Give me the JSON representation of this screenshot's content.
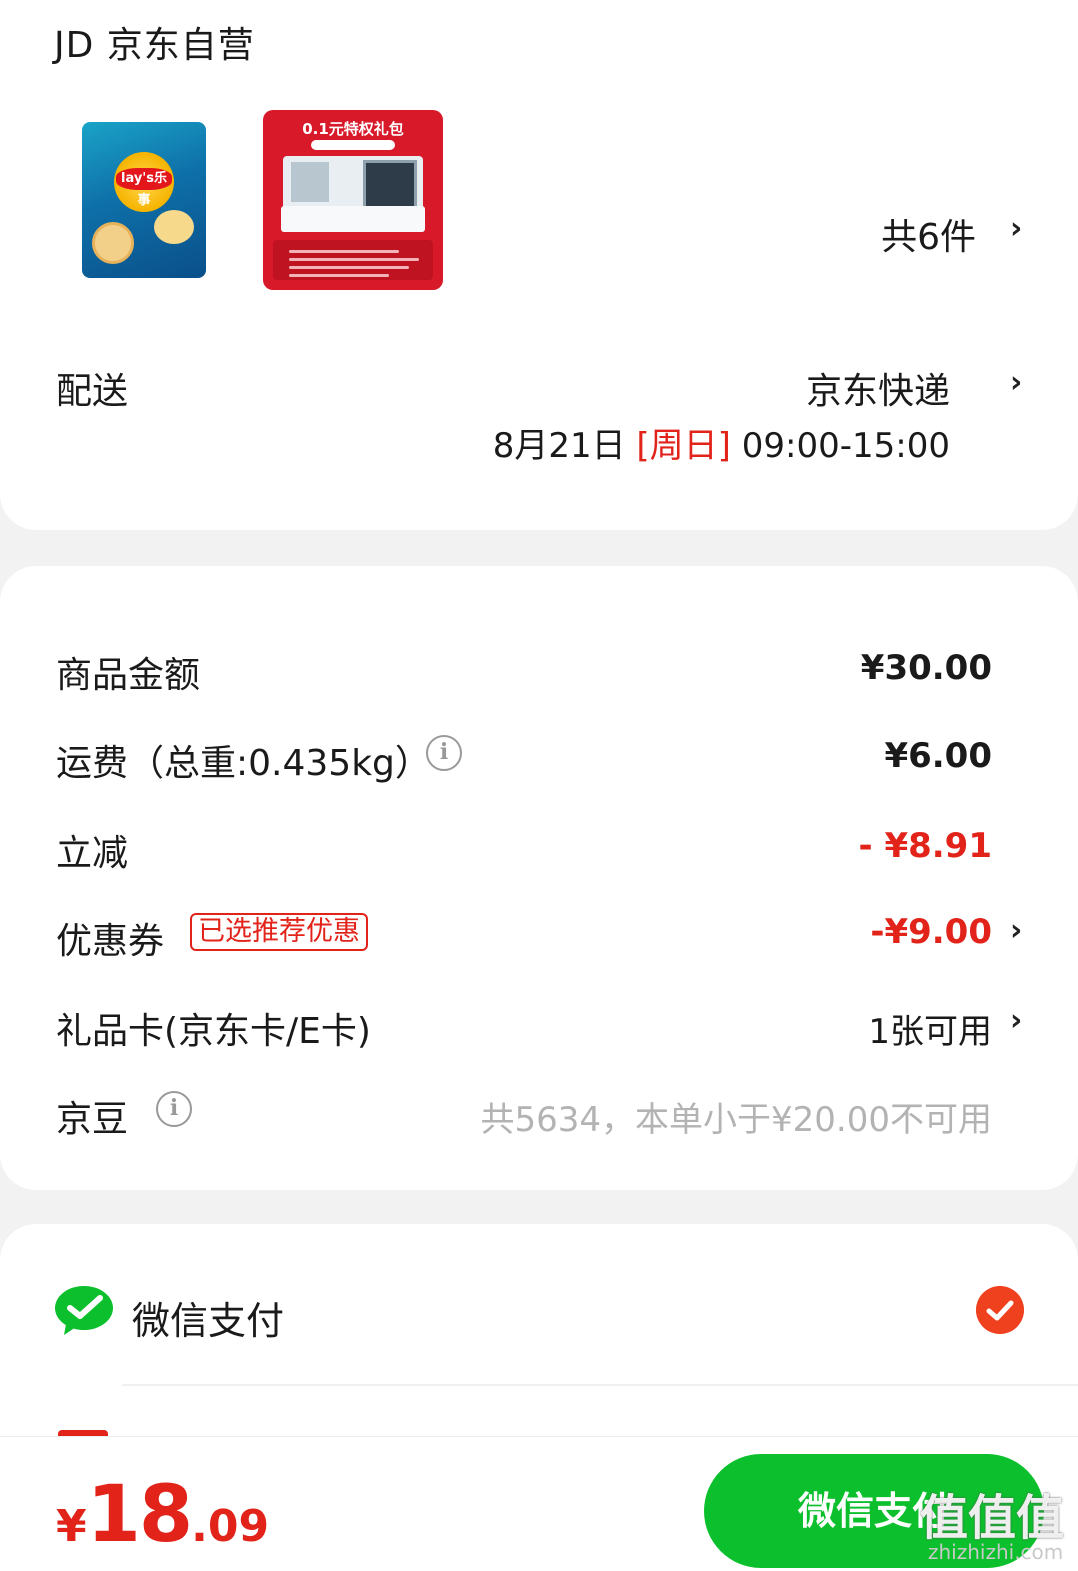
{
  "shop": {
    "logo": "JD",
    "name": "京东自营"
  },
  "products": {
    "items": [
      {
        "name": "lay's乐事",
        "icon": "lays-chips-bag"
      },
      {
        "name": "0.1元特权礼包",
        "icon": "gift-pack"
      }
    ],
    "count_label": "共6件"
  },
  "delivery": {
    "label": "配送",
    "method": "京东快递",
    "date": "8月21日",
    "weekday": "[周日]",
    "time": "09:00-15:00"
  },
  "fees": {
    "goods": {
      "label": "商品金额",
      "value": "¥30.00"
    },
    "shipping": {
      "label": "运费（总重:0.435kg）",
      "value": "¥6.00"
    },
    "discount": {
      "label": "立减",
      "value": "- ¥8.91"
    },
    "coupon": {
      "label": "优惠券",
      "badge": "已选推荐优惠",
      "value": "-¥9.00"
    },
    "giftcard": {
      "label": "礼品卡(京东卡/E卡)",
      "value": "1张可用"
    },
    "jingdou": {
      "label": "京豆",
      "value": "共5634，本单小于¥20.00不可用"
    }
  },
  "payment": {
    "method": "微信支付",
    "selected": true
  },
  "footer": {
    "currency": "¥",
    "total_int": "18",
    "total_dec": ".09",
    "pay_button": "微信支付",
    "watermark": "值值值",
    "watermark_sub": "zhizhizhi.com"
  },
  "colors": {
    "accent_red": "#e2231a",
    "wechat_green": "#0bc02c"
  }
}
